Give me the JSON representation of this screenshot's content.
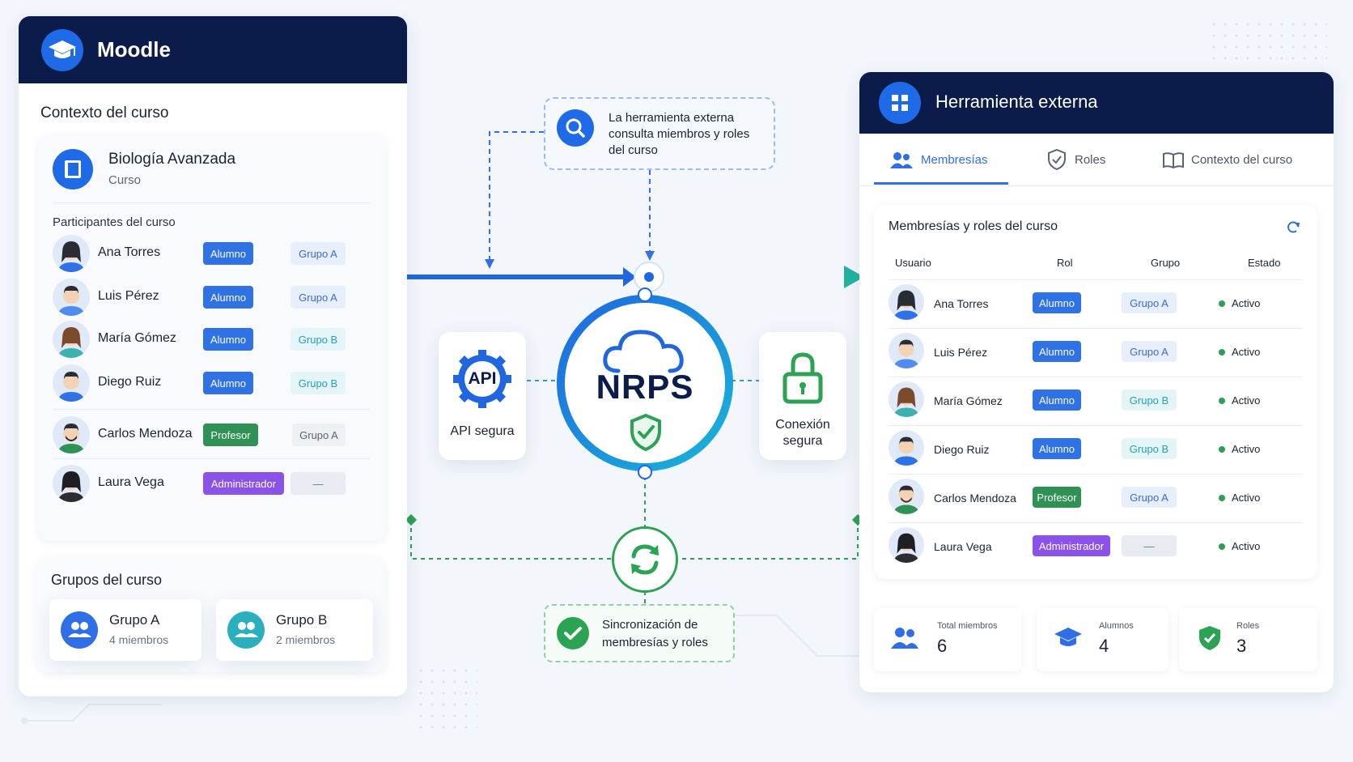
{
  "moodle": {
    "title": "Moodle",
    "context_heading": "Contexto del curso",
    "course_name": "Biología Avanzada",
    "course_type": "Curso",
    "participants_heading": "Participantes del curso",
    "participants": [
      {
        "name": "Ana Torres",
        "role": "Alumno",
        "group": "Grupo A"
      },
      {
        "name": "Luis Pérez",
        "role": "Alumno",
        "group": "Grupo A"
      },
      {
        "name": "María Gómez",
        "role": "Alumno",
        "group": "Grupo B"
      },
      {
        "name": "Diego Ruiz",
        "role": "Alumno",
        "group": "Grupo B"
      },
      {
        "name": "Carlos Mendoza",
        "role": "Profesor",
        "group": "Grupo A"
      },
      {
        "name": "Laura Vega",
        "role": "Administrador",
        "group": "—"
      }
    ],
    "groups_heading": "Grupos del curso",
    "groups": [
      {
        "name": "Grupo A",
        "members": "4 miembros"
      },
      {
        "name": "Grupo B",
        "members": "2 miembros"
      }
    ]
  },
  "center": {
    "query_note": "La herramienta externa consulta miembros y roles del curso",
    "nrps_label": "NRPS",
    "api_badge": "API",
    "api_label": "API segura",
    "secure_label_1": "Conexión",
    "secure_label_2": "segura",
    "sync_label_1": "Sincronización de",
    "sync_label_2": "membresías y roles"
  },
  "tool": {
    "title": "Herramienta externa",
    "tabs": [
      "Membresías",
      "Roles",
      "Contexto del curso"
    ],
    "active_tab": 0,
    "table_heading": "Membresías y roles del curso",
    "columns": [
      "Usuario",
      "Rol",
      "Grupo",
      "Estado"
    ],
    "rows": [
      {
        "name": "Ana Torres",
        "role": "Alumno",
        "group": "Grupo A",
        "status": "Activo"
      },
      {
        "name": "Luis Pérez",
        "role": "Alumno",
        "group": "Grupo A",
        "status": "Activo"
      },
      {
        "name": "María Gómez",
        "role": "Alumno",
        "group": "Grupo B",
        "status": "Activo"
      },
      {
        "name": "Diego Ruiz",
        "role": "Alumno",
        "group": "Grupo B",
        "status": "Activo"
      },
      {
        "name": "Carlos Mendoza",
        "role": "Profesor",
        "group": "Grupo A",
        "status": "Activo"
      },
      {
        "name": "Laura Vega",
        "role": "Administrador",
        "group": "—",
        "status": "Activo"
      }
    ],
    "stats": [
      {
        "label": "Total miembros",
        "value": "6"
      },
      {
        "label": "Alumnos",
        "value": "4"
      },
      {
        "label": "Roles",
        "value": "3"
      }
    ]
  },
  "colors": {
    "navy": "#0b1c4b",
    "blue": "#2f72e6",
    "green": "#2f9254",
    "purple": "#8b52ea",
    "teal": "#21b3b0"
  }
}
